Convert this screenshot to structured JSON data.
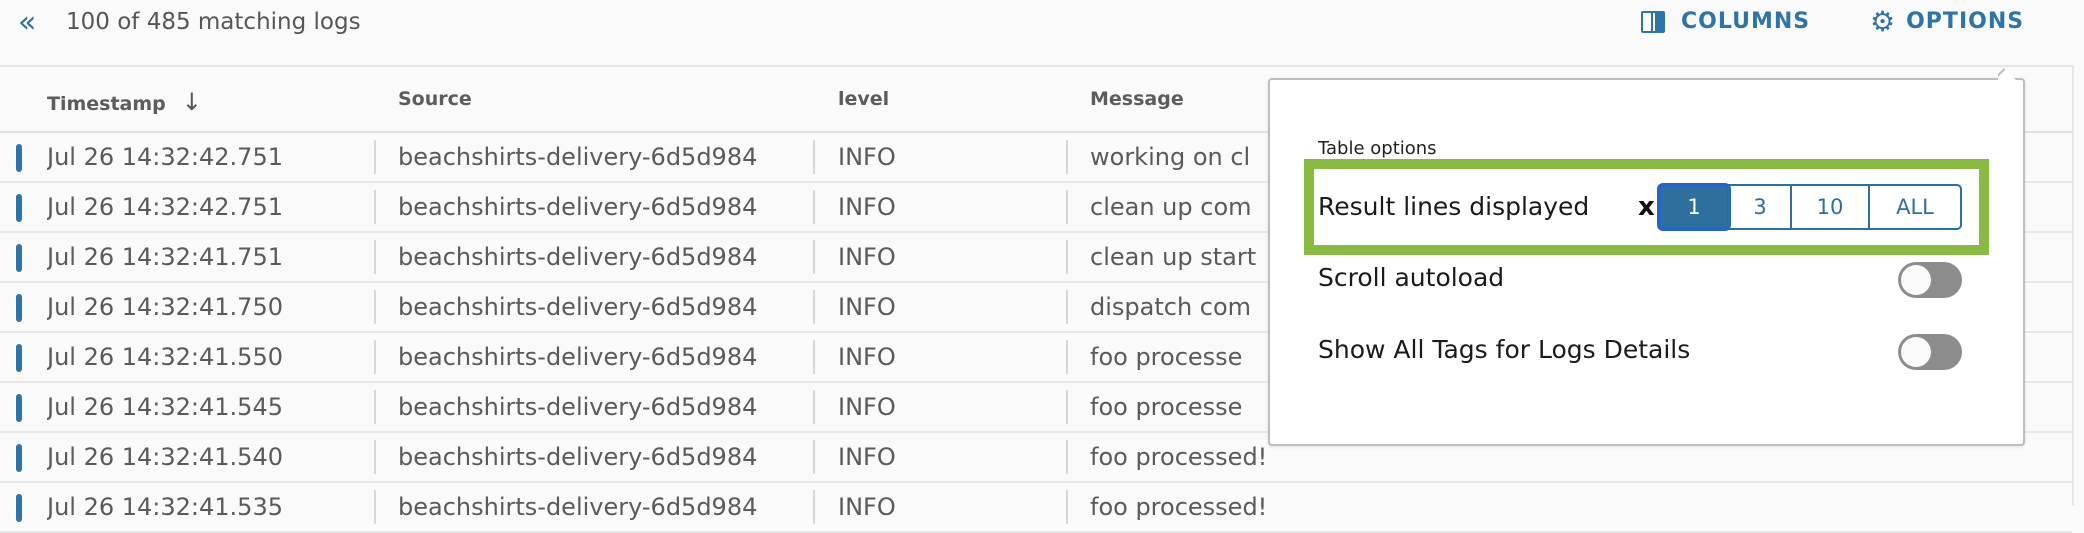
{
  "header": {
    "count_text": "100 of 485 matching logs",
    "collapse_icon": "double-chevron-left",
    "columns_label": "COLUMNS",
    "options_label": "OPTIONS"
  },
  "table": {
    "columns": [
      "Timestamp",
      "Source",
      "level",
      "Message"
    ],
    "sort_icon": "↓",
    "rows": [
      {
        "timestamp": "Jul 26 14:32:42.751",
        "source": "beachshirts-delivery-6d5d984",
        "level": "INFO",
        "message": "working on cl"
      },
      {
        "timestamp": "Jul 26 14:32:42.751",
        "source": "beachshirts-delivery-6d5d984",
        "level": "INFO",
        "message": "clean up com"
      },
      {
        "timestamp": "Jul 26 14:32:41.751",
        "source": "beachshirts-delivery-6d5d984",
        "level": "INFO",
        "message": "clean up start"
      },
      {
        "timestamp": "Jul 26 14:32:41.750",
        "source": "beachshirts-delivery-6d5d984",
        "level": "INFO",
        "message": "dispatch com"
      },
      {
        "timestamp": "Jul 26 14:32:41.550",
        "source": "beachshirts-delivery-6d5d984",
        "level": "INFO",
        "message": "foo processe"
      },
      {
        "timestamp": "Jul 26 14:32:41.545",
        "source": "beachshirts-delivery-6d5d984",
        "level": "INFO",
        "message": "foo processe"
      },
      {
        "timestamp": "Jul 26 14:32:41.540",
        "source": "beachshirts-delivery-6d5d984",
        "level": "INFO",
        "message": "foo processed!"
      },
      {
        "timestamp": "Jul 26 14:32:41.535",
        "source": "beachshirts-delivery-6d5d984",
        "level": "INFO",
        "message": "foo processed!"
      }
    ]
  },
  "options_panel": {
    "title": "Table options",
    "result_lines_label": "Result lines displayed",
    "x_mark": "x",
    "result_lines_options": [
      "1",
      "3",
      "10",
      "ALL"
    ],
    "result_lines_selected": "1",
    "scroll_autoload_label": "Scroll autoload",
    "scroll_autoload_on": false,
    "show_all_tags_label": "Show All Tags for Logs Details",
    "show_all_tags_on": false
  },
  "colors": {
    "accent": "#2f74a8",
    "highlight": "#8aba44",
    "focus": "#2563c9"
  }
}
